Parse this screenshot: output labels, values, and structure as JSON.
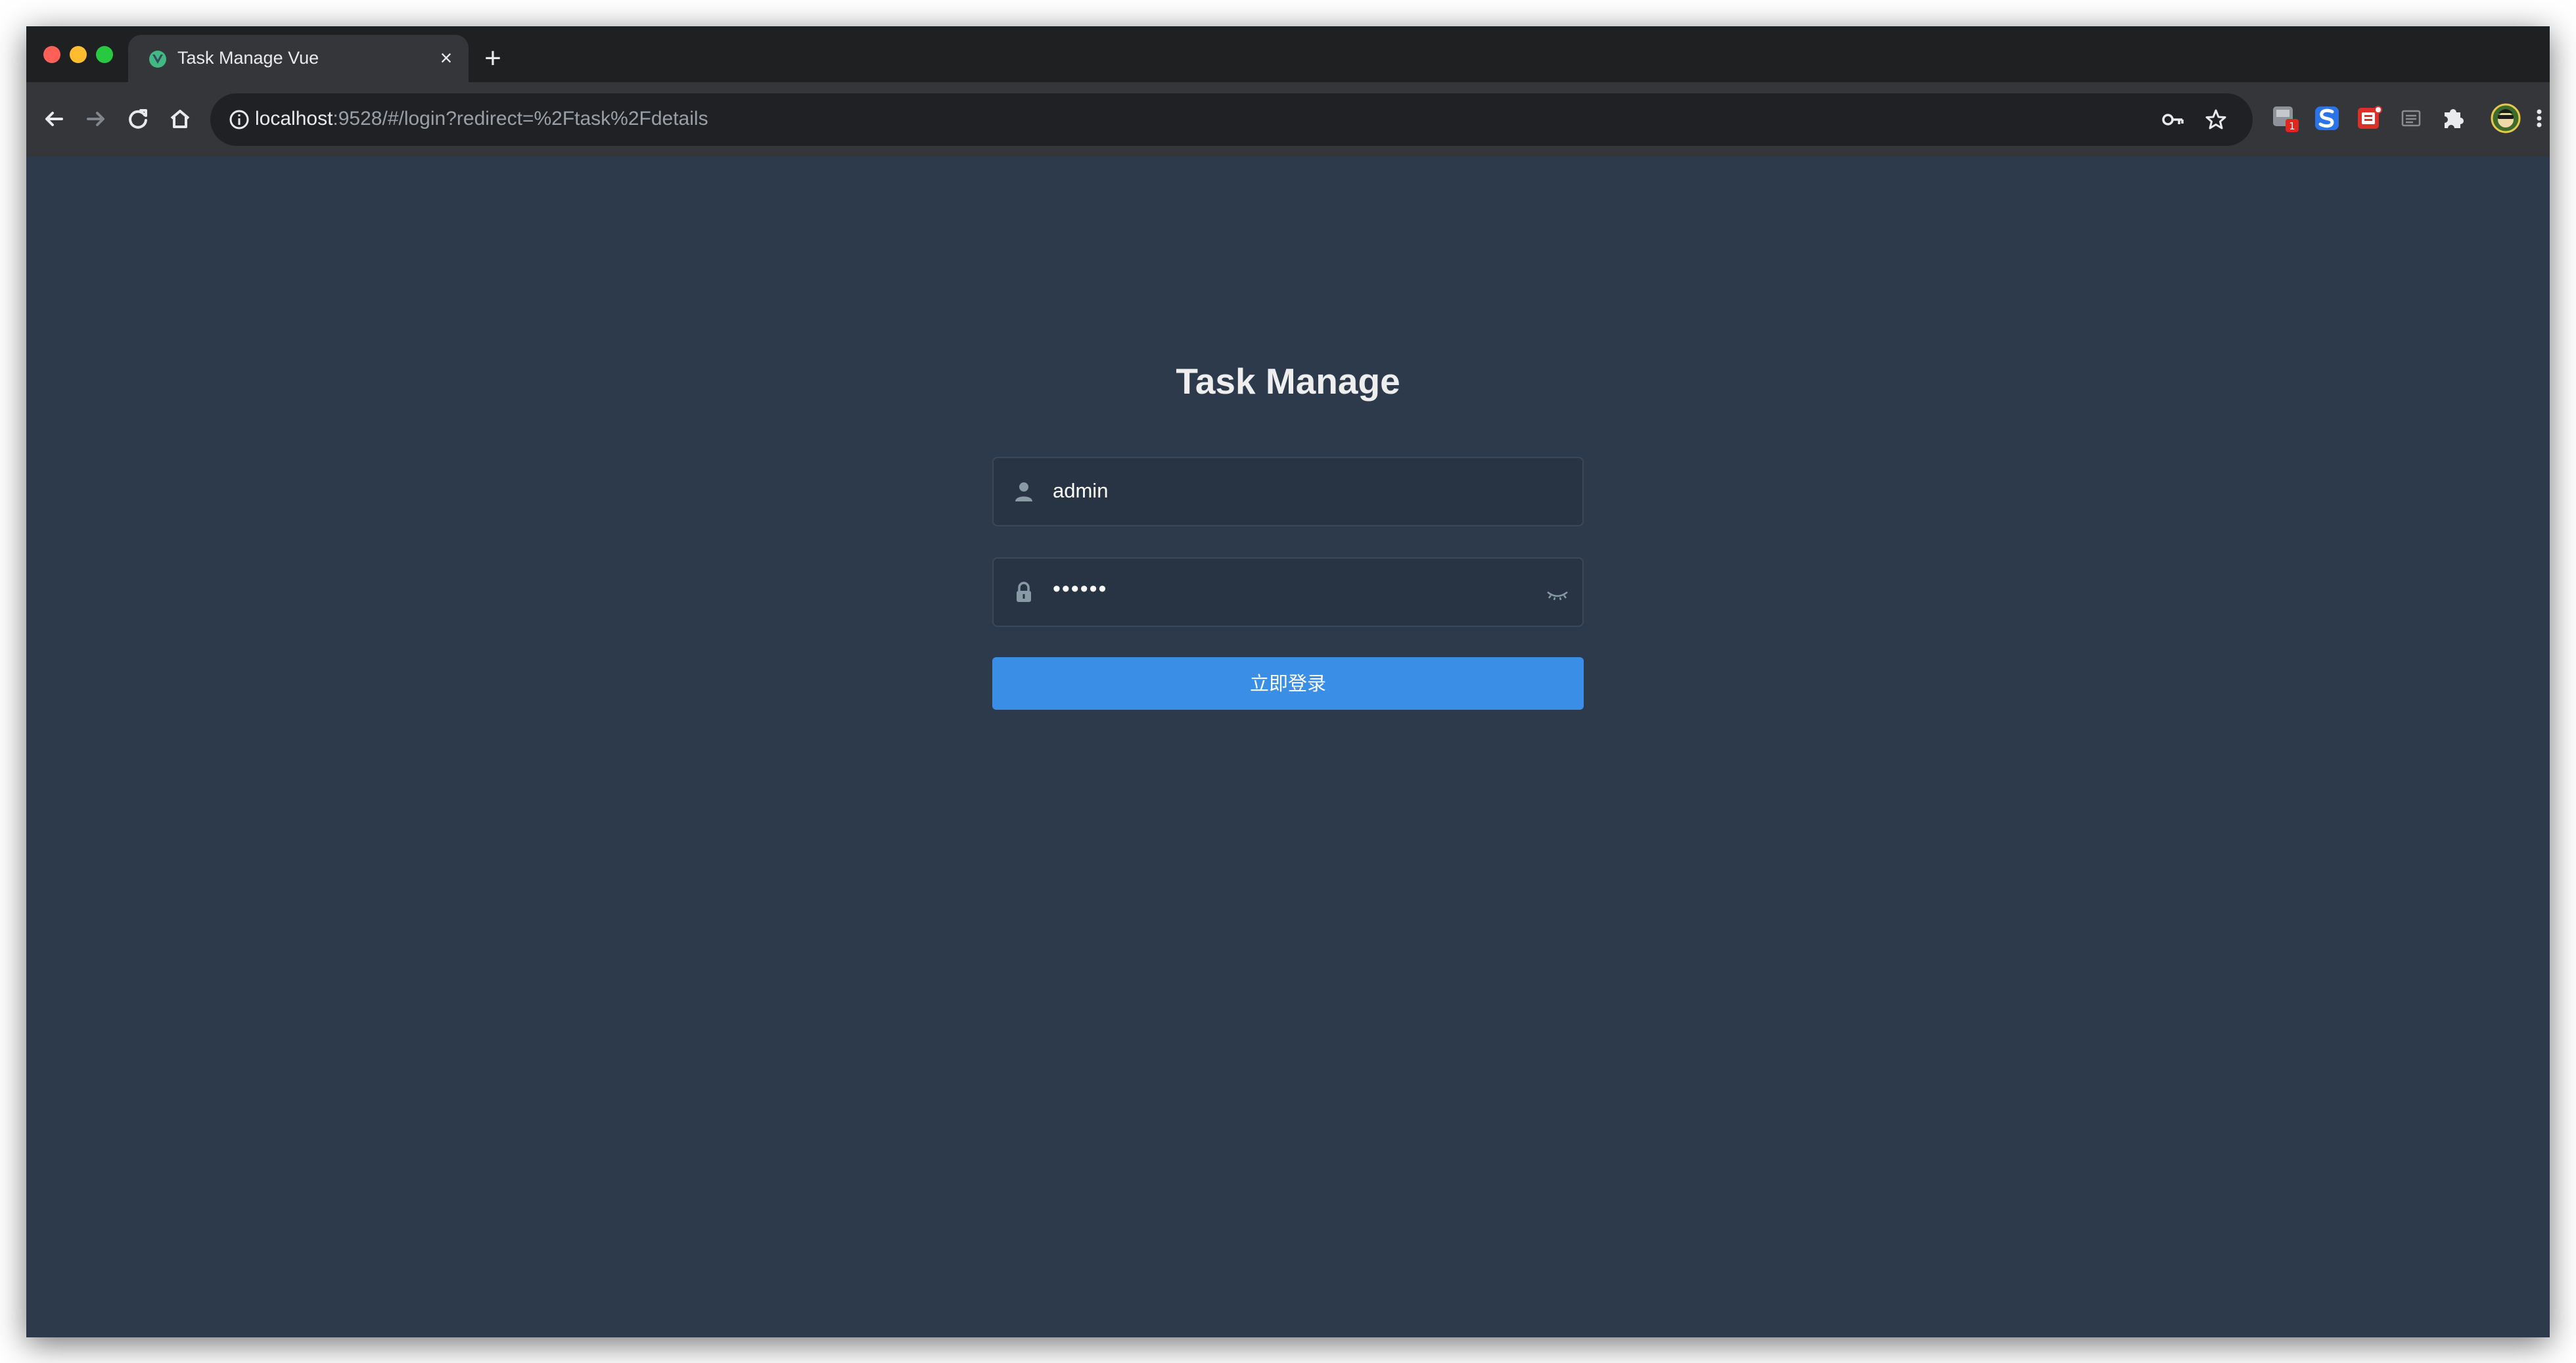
{
  "browser": {
    "tab": {
      "title": "Task Manage Vue"
    },
    "address_bar": {
      "host": "localhost",
      "rest": ":9528/#/login?redirect=%2Ftask%2Fdetails"
    },
    "extensions": [
      {
        "icon": "extension-badge-icon",
        "badge": "1"
      },
      {
        "icon": "s-extension-icon"
      },
      {
        "icon": "red-extension-icon"
      },
      {
        "icon": "reader-icon"
      },
      {
        "icon": "puzzle-icon"
      },
      {
        "icon": "profile-avatar"
      },
      {
        "icon": "kebab-menu-icon"
      }
    ]
  },
  "login": {
    "title": "Task Manage",
    "username": {
      "value": "admin",
      "icon": "user-icon"
    },
    "password": {
      "masked_value": "••••••",
      "icon": "lock-icon",
      "toggle_icon": "eye-closed-icon"
    },
    "submit_label": "立即登录"
  },
  "colors": {
    "page_background": "#2d3a4b",
    "input_background": "#283443",
    "button": "#3a8ee6",
    "title_text": "#eeeeee"
  }
}
